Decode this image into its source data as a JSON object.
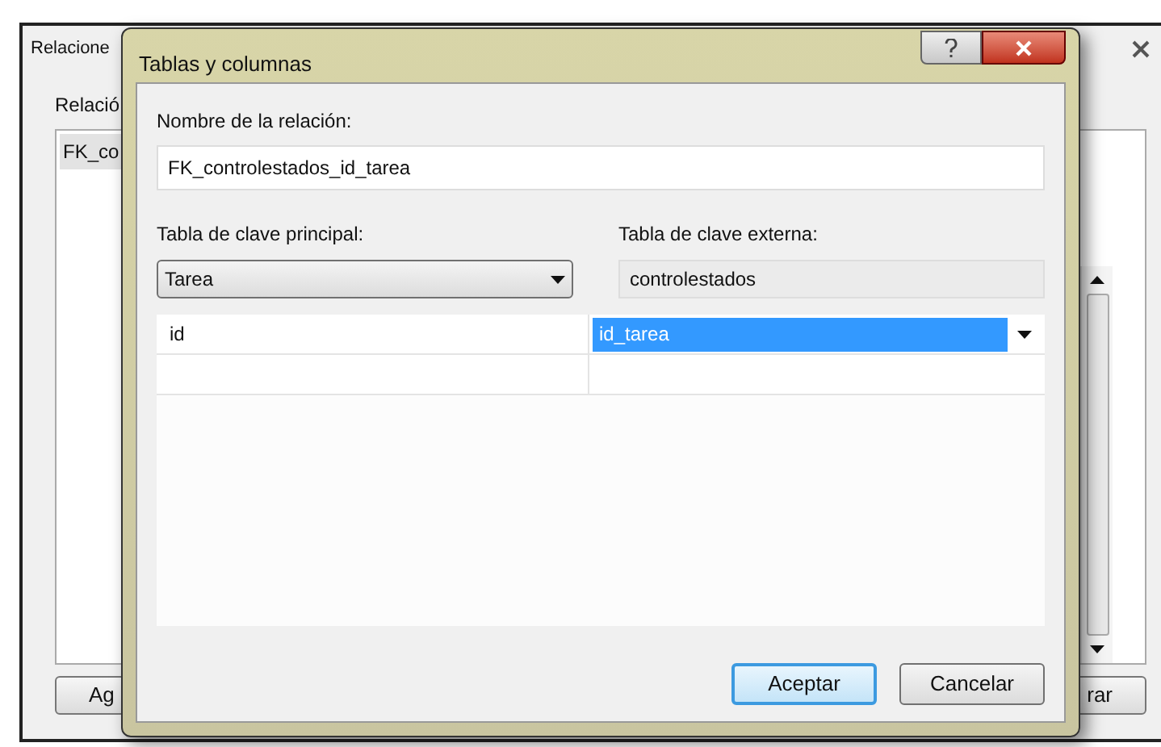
{
  "background_window": {
    "title": "Relacione",
    "list_label": "Relació",
    "list_items": [
      {
        "label": "FK_co",
        "selected": true
      }
    ],
    "buttons": [
      "Ag",
      "rar"
    ]
  },
  "dialog": {
    "title": "Tablas y columnas",
    "name_label": "Nombre de la relación:",
    "name_value": "FK_controlestados_id_tarea",
    "primary_label": "Tabla de clave principal:",
    "primary_value": "Tarea",
    "foreign_label": "Tabla de clave externa:",
    "foreign_value": "controlestados",
    "rows": [
      {
        "column_1": "id",
        "column_2": "id_tarea",
        "selected": true
      }
    ],
    "buttons": [
      {
        "label": "Aceptar",
        "default": true
      },
      {
        "label": "Cancelar",
        "default": false
      }
    ]
  }
}
